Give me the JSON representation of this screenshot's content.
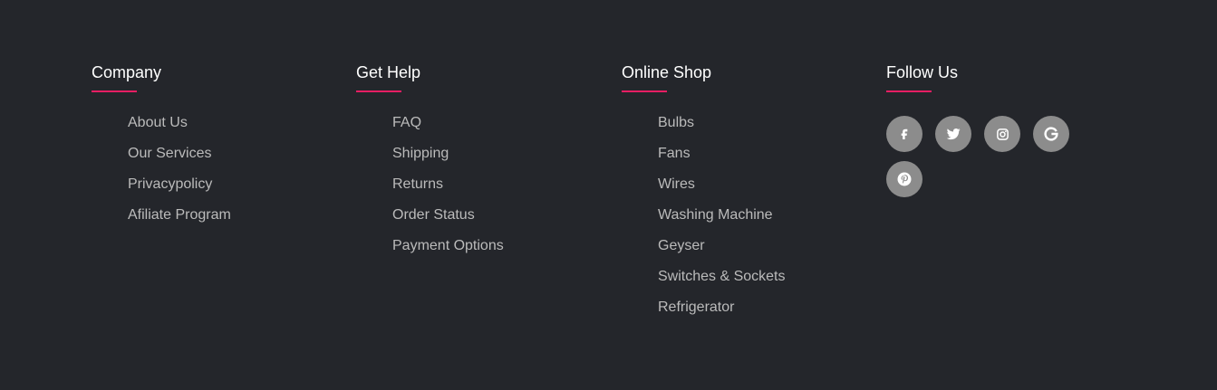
{
  "company": {
    "title": "Company",
    "links": [
      "About Us",
      "Our Services",
      "Privacypolicy",
      "Afiliate Program"
    ]
  },
  "help": {
    "title": "Get Help",
    "links": [
      "FAQ",
      "Shipping",
      "Returns",
      "Order Status",
      "Payment Options"
    ]
  },
  "shop": {
    "title": "Online Shop",
    "links": [
      "Bulbs",
      "Fans",
      "Wires",
      "Washing Machine",
      "Geyser",
      "Switches & Sockets",
      "Refrigerator"
    ]
  },
  "follow": {
    "title": "Follow Us",
    "icons": [
      "facebook-icon",
      "twitter-icon",
      "instagram-icon",
      "google-icon",
      "pinterest-icon"
    ]
  },
  "colors": {
    "background": "#24262b",
    "accent": "#e91e63",
    "link_text": "#bbbbbb",
    "heading_text": "#ffffff",
    "social_button": "#8c8c8c"
  }
}
